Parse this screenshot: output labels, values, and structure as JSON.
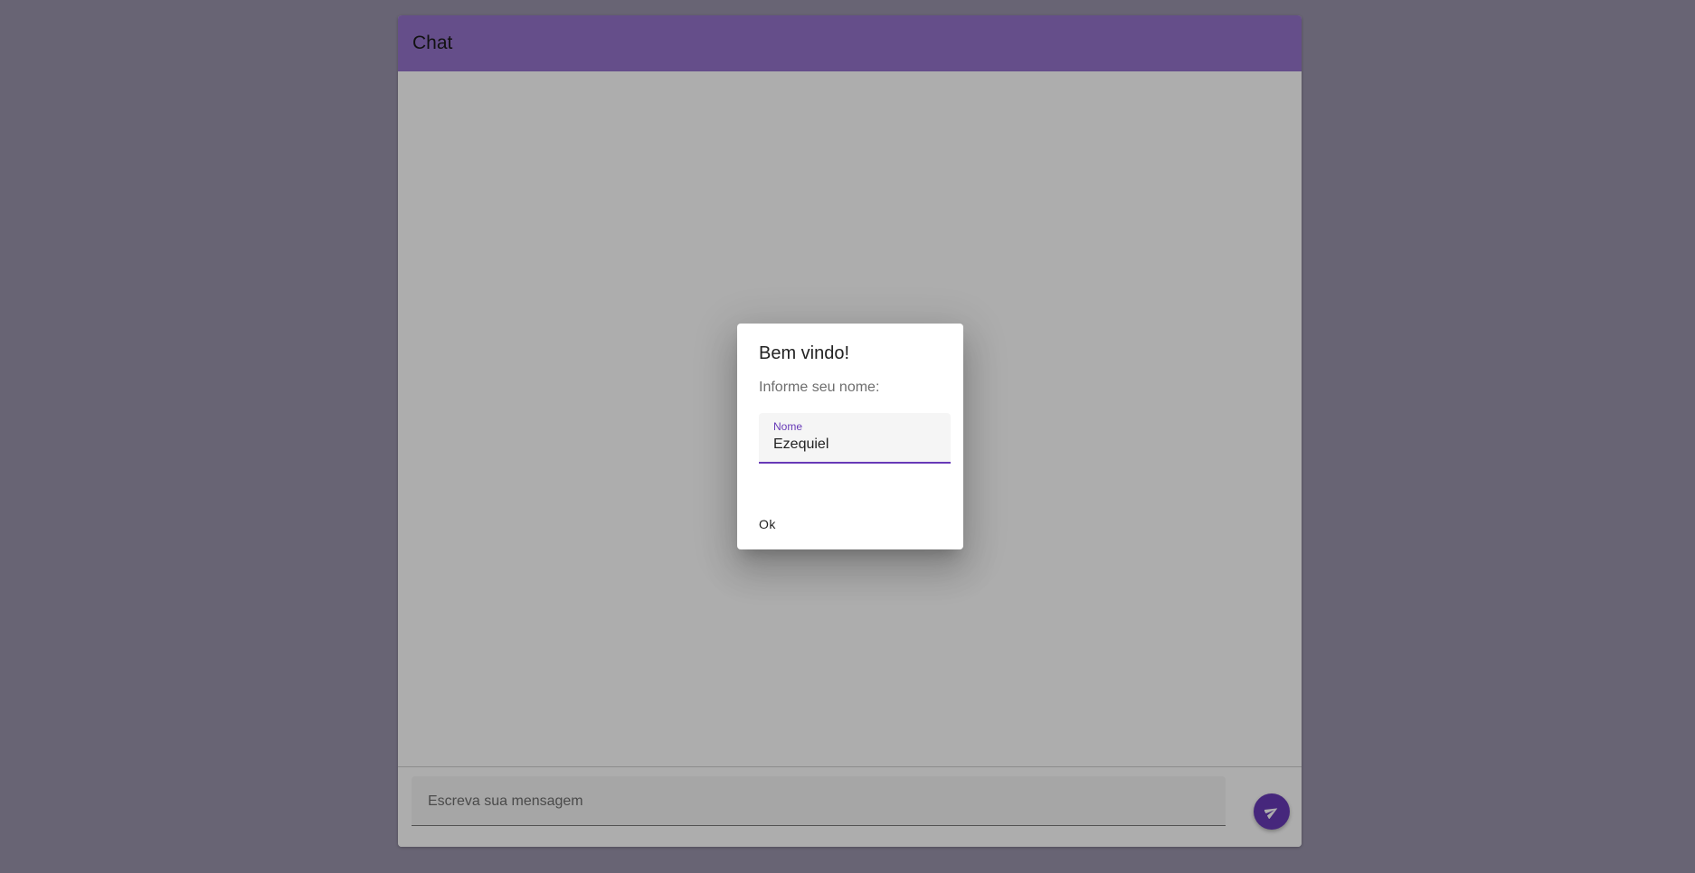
{
  "header": {
    "title": "Chat"
  },
  "composer": {
    "placeholder": "Escreva sua mensagem",
    "value": "",
    "send_icon": "send-icon"
  },
  "dialog": {
    "title": "Bem vindo!",
    "subtitle": "Informe seu nome:",
    "name_field": {
      "label": "Nome",
      "value": "Ezequiel"
    },
    "ok_label": "Ok"
  },
  "colors": {
    "background": "#9a94ab",
    "header": "#9574cc",
    "accent": "#673ab7"
  }
}
